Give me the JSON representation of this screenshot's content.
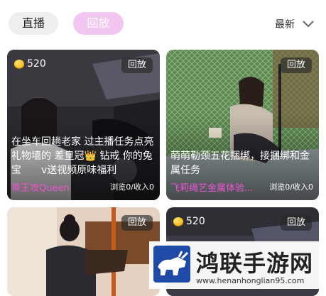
{
  "tabs": {
    "live": "直播",
    "replay": "回放"
  },
  "sort": {
    "label": "最新"
  },
  "cards": [
    {
      "coins": "520",
      "badge": "回放",
      "title": "在坐车回趟老家 过主播任务点亮礼物墙的 差皇冠👑 钻戒 你的兔宝　　v送视频原味福利",
      "author": "蒂王攻Queen",
      "stats": "浏览0/收入0"
    },
    {
      "badge": "回放",
      "title": "萌萌勒颈五花捆绑，接捆绑和金属任务",
      "author": "飞莉绳艺金属体验...",
      "stats": "浏览0/收入0"
    },
    {
      "badge": "回放"
    },
    {
      "coins": "520",
      "badge": "回放"
    }
  ],
  "watermark": {
    "title": "鸿联手游网",
    "url": "www.henanhonglian95.com"
  },
  "colors": {
    "accent_pink": "#ee55d6",
    "tab_active_bg": "#f2c6f0"
  }
}
